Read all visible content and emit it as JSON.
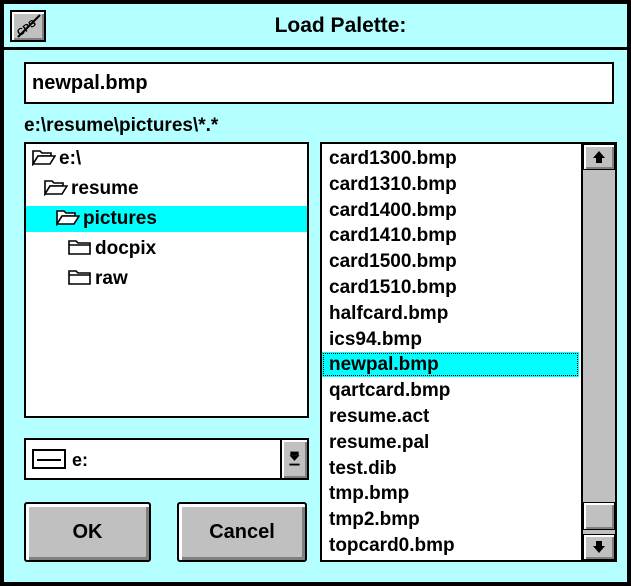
{
  "window": {
    "title": "Load Palette:",
    "system_icon": "cps-pencil-icon",
    "system_icon_text": "CPS"
  },
  "filename": {
    "value": "newpal.bmp"
  },
  "current_path": "e:\\resume\\pictures\\*.*",
  "directories": [
    {
      "label": "e:\\",
      "icon": "folder-open-icon",
      "selected": false
    },
    {
      "label": "resume",
      "icon": "folder-open-icon",
      "selected": false
    },
    {
      "label": "pictures",
      "icon": "folder-open-icon",
      "selected": true
    },
    {
      "label": "docpix",
      "icon": "folder-closed-icon",
      "selected": false
    },
    {
      "label": "raw",
      "icon": "folder-closed-icon",
      "selected": false
    }
  ],
  "files": [
    "card1300.bmp",
    "card1310.bmp",
    "card1400.bmp",
    "card1410.bmp",
    "card1500.bmp",
    "card1510.bmp",
    "halfcard.bmp",
    "ics94.bmp",
    "newpal.bmp",
    "qartcard.bmp",
    "resume.act",
    "resume.pal",
    "test.dib",
    "tmp.bmp",
    "tmp2.bmp",
    "topcard0.bmp"
  ],
  "selected_file": "newpal.bmp",
  "drive": {
    "label": "e:",
    "icon": "drive-icon"
  },
  "buttons": {
    "ok": "OK",
    "cancel": "Cancel"
  },
  "colors": {
    "dialog_bg": "#b4ffff",
    "selection": "#00ffff",
    "button_face": "#c0c0c0"
  }
}
